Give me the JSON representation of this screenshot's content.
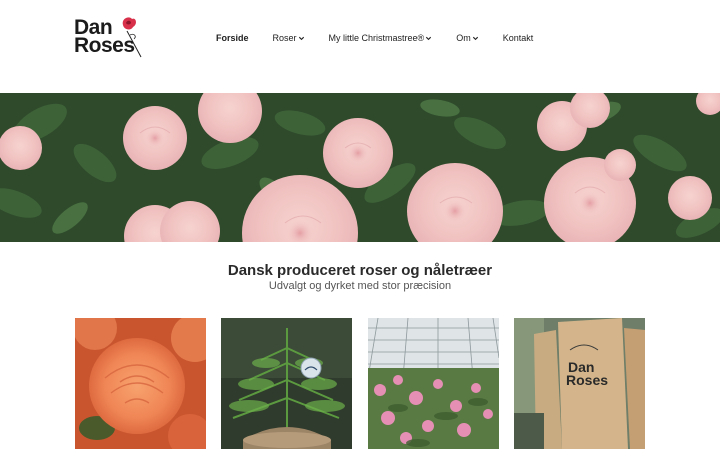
{
  "brand": {
    "line1": "Dan",
    "line2": "Roses"
  },
  "nav": {
    "items": [
      {
        "label": "Forside",
        "active": true,
        "has_dropdown": false
      },
      {
        "label": "Roser",
        "active": false,
        "has_dropdown": true
      },
      {
        "label": "My little Christmastree®",
        "active": false,
        "has_dropdown": true
      },
      {
        "label": "Om",
        "active": false,
        "has_dropdown": true
      },
      {
        "label": "Kontakt",
        "active": false,
        "has_dropdown": false
      }
    ]
  },
  "hero": {
    "image": "pink-roses-banner"
  },
  "intro": {
    "title": "Dansk produceret roser og nåletræer",
    "subtitle": "Udvalgt og dyrket med stor præcision"
  },
  "cards": [
    {
      "image": "orange-rose"
    },
    {
      "image": "christmas-tree-ornament"
    },
    {
      "image": "greenhouse-roses"
    },
    {
      "image": "danroses-paper-bags",
      "bag_text_1": "Dan",
      "bag_text_2": "Roses"
    }
  ],
  "colors": {
    "text": "#222222",
    "rose_pink": "#f2c6c6",
    "leaf_green": "#3c5e36"
  }
}
